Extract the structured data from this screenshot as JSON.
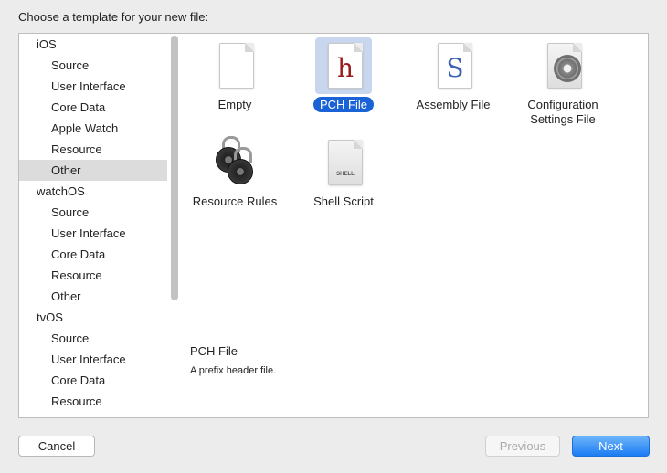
{
  "dialog": {
    "prompt": "Choose a template for your new file:"
  },
  "sidebar": {
    "groups": [
      {
        "label": "iOS",
        "items": [
          "Source",
          "User Interface",
          "Core Data",
          "Apple Watch",
          "Resource",
          "Other"
        ]
      },
      {
        "label": "watchOS",
        "items": [
          "Source",
          "User Interface",
          "Core Data",
          "Resource",
          "Other"
        ]
      },
      {
        "label": "tvOS",
        "items": [
          "Source",
          "User Interface",
          "Core Data",
          "Resource"
        ]
      }
    ],
    "selected": "iOS/Other"
  },
  "templates": [
    {
      "label": "Empty",
      "icon": "empty-document-icon",
      "glyph": ""
    },
    {
      "label": "PCH File",
      "icon": "pch-file-icon",
      "glyph": "h",
      "glyph_color": "#9b1c1c",
      "selected": true
    },
    {
      "label": "Assembly File",
      "icon": "assembly-file-icon",
      "glyph": "S",
      "glyph_color": "#3a5fb4"
    },
    {
      "label": "Configuration Settings File",
      "icon": "configuration-settings-icon",
      "glyph": ""
    },
    {
      "label": "Resource Rules",
      "icon": "padlock-icon",
      "glyph": ""
    },
    {
      "label": "Shell Script",
      "icon": "shell-script-icon",
      "glyph": "SHELL"
    }
  ],
  "description": {
    "title": "PCH File",
    "text": "A prefix header file."
  },
  "buttons": {
    "cancel": "Cancel",
    "previous": "Previous",
    "next": "Next"
  },
  "colors": {
    "accent": "#1a63d6",
    "selection_bg": "#c9d7ee",
    "sidebar_selected": "#dcdcdc"
  }
}
